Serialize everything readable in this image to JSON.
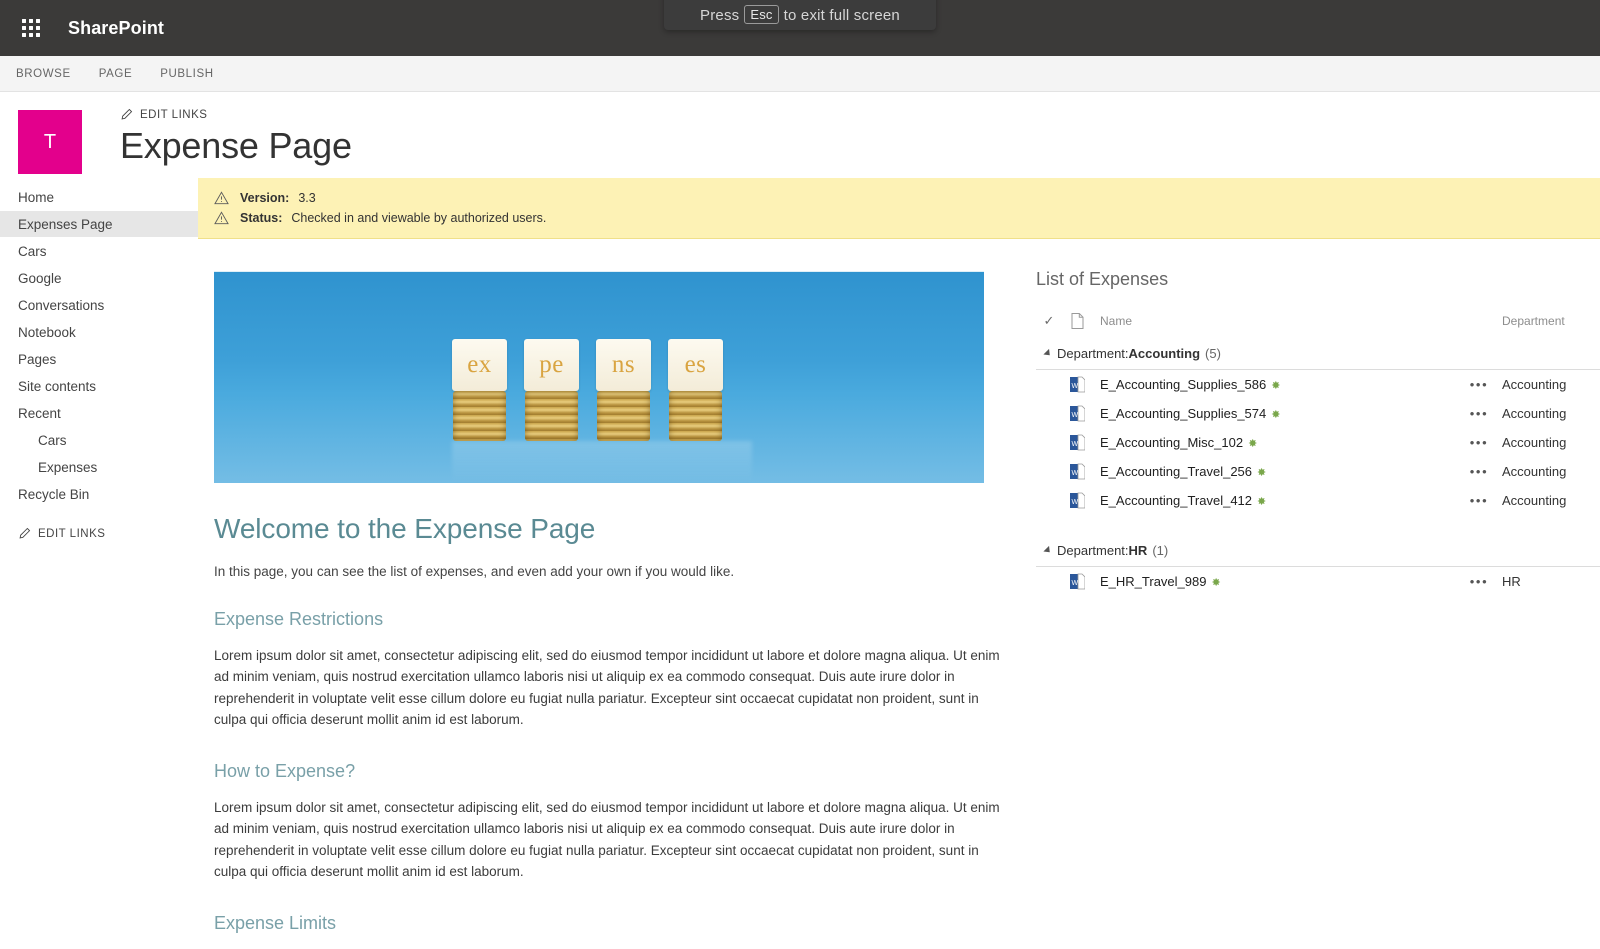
{
  "fullscreen_toast": {
    "before": "Press",
    "key": "Esc",
    "after": "to exit full screen"
  },
  "suite": {
    "title": "SharePoint",
    "waffle_icon": "waffle-grid-icon"
  },
  "ribbon": {
    "tabs": [
      "BROWSE",
      "PAGE",
      "PUBLISH"
    ]
  },
  "site": {
    "logo_letter": "T",
    "edit_links_top": "EDIT LINKS",
    "page_title": "Expense Page"
  },
  "quick_launch": {
    "items": [
      {
        "label": "Home",
        "selected": false,
        "child": false
      },
      {
        "label": "Expenses Page",
        "selected": true,
        "child": false
      },
      {
        "label": "Cars",
        "selected": false,
        "child": false
      },
      {
        "label": "Google",
        "selected": false,
        "child": false
      },
      {
        "label": "Conversations",
        "selected": false,
        "child": false
      },
      {
        "label": "Notebook",
        "selected": false,
        "child": false
      },
      {
        "label": "Pages",
        "selected": false,
        "child": false
      },
      {
        "label": "Site contents",
        "selected": false,
        "child": false
      },
      {
        "label": "Recent",
        "selected": false,
        "child": false
      },
      {
        "label": "Cars",
        "selected": false,
        "child": true
      },
      {
        "label": "Expenses",
        "selected": false,
        "child": true
      },
      {
        "label": "Recycle Bin",
        "selected": false,
        "child": false
      }
    ],
    "edit_links_bottom": "EDIT LINKS"
  },
  "status_bar": {
    "version_label": "Version:",
    "version_value": "3.3",
    "status_label": "Status:",
    "status_value": "Checked in and viewable by authorized users.",
    "background": "#fdf2b5"
  },
  "banner": {
    "alt": "expenses-coin-stacks-image",
    "blocks": [
      "ex",
      "pe",
      "ns",
      "es"
    ]
  },
  "main": {
    "welcome_heading": "Welcome to the Expense Page",
    "welcome_sub": "In this page, you can see the list of expenses, and even add your own if you would like.",
    "sections": [
      {
        "heading": "Expense Restrictions",
        "body": "Lorem ipsum dolor sit amet, consectetur adipiscing elit, sed do eiusmod tempor incididunt ut labore et dolore magna aliqua. Ut enim ad minim veniam, quis nostrud exercitation ullamco laboris nisi ut aliquip ex ea commodo consequat. Duis aute irure dolor in reprehenderit in voluptate velit esse cillum dolore eu fugiat nulla pariatur. Excepteur sint occaecat cupidatat non proident, sunt in culpa qui officia deserunt mollit anim id est laborum."
      },
      {
        "heading": "How to Expense?",
        "body": "Lorem ipsum dolor sit amet, consectetur adipiscing elit, sed do eiusmod tempor incididunt ut labore et dolore magna aliqua. Ut enim ad minim veniam, quis nostrud exercitation ullamco laboris nisi ut aliquip ex ea commodo consequat. Duis aute irure dolor in reprehenderit in voluptate velit esse cillum dolore eu fugiat nulla pariatur. Excepteur sint occaecat cupidatat non proident, sunt in culpa qui officia deserunt mollit anim id est laborum."
      },
      {
        "heading": "Expense Limits",
        "body": ""
      }
    ]
  },
  "expenses_webpart": {
    "title": "List of Expenses",
    "columns": {
      "check": "✓",
      "doc": "document-icon",
      "name": "Name",
      "ellipsis": "",
      "department": "Department"
    },
    "groups": [
      {
        "field": "Department",
        "value": "Accounting",
        "count": "(5)",
        "rows": [
          {
            "name": "E_Accounting_Supplies_586",
            "new": true,
            "ellipsis": "•••",
            "department": "Accounting"
          },
          {
            "name": "E_Accounting_Supplies_574",
            "new": true,
            "ellipsis": "•••",
            "department": "Accounting"
          },
          {
            "name": "E_Accounting_Misc_102",
            "new": true,
            "ellipsis": "•••",
            "department": "Accounting"
          },
          {
            "name": "E_Accounting_Travel_256",
            "new": true,
            "ellipsis": "•••",
            "department": "Accounting"
          },
          {
            "name": "E_Accounting_Travel_412",
            "new": true,
            "ellipsis": "•••",
            "department": "Accounting"
          }
        ]
      },
      {
        "field": "Department",
        "value": "HR",
        "count": "(1)",
        "rows": [
          {
            "name": "E_HR_Travel_989",
            "new": true,
            "ellipsis": "•••",
            "department": "HR"
          }
        ]
      }
    ],
    "group_separator": " : ",
    "new_badge": "✸"
  }
}
